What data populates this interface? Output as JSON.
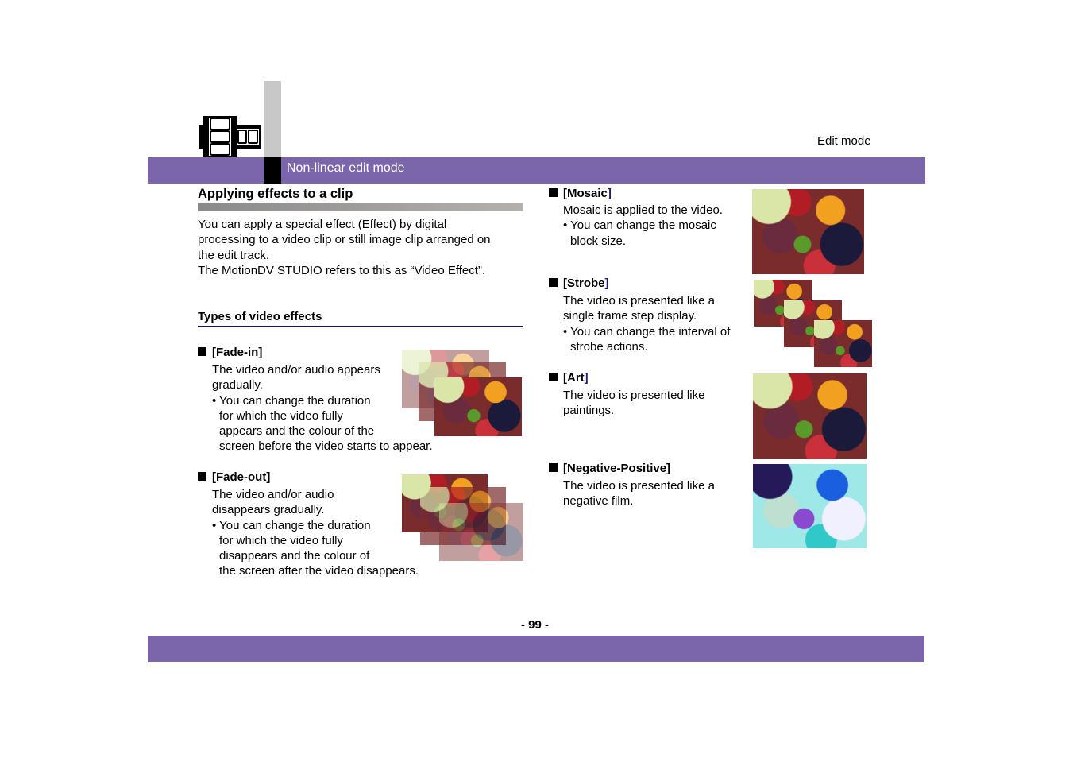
{
  "header": {
    "section_title": "Non-linear edit mode",
    "chapter": "Edit mode",
    "icon": "film-strip-icon",
    "accent_color": "#7b66ab"
  },
  "intro": {
    "heading": "Applying effects to a clip",
    "paragraph_lines": [
      "You can apply a special effect (Effect) by digital",
      "processing to a video clip or still image clip arranged on",
      "the edit track.",
      "The MotionDV STUDIO refers to this as “Video Effect”."
    ]
  },
  "types": {
    "heading": "Types of video effects"
  },
  "effects": [
    {
      "name": "Fade-in",
      "description_lines": [
        "The video and/or audio appears",
        "gradually."
      ],
      "bullet_lines": [
        "• You can change the duration",
        "for which the video fully",
        "appears and the colour of the",
        "screen before the video starts to appear."
      ],
      "image": "fade-in-preview"
    },
    {
      "name": "Fade-out",
      "description_lines": [
        "The video and/or audio",
        "disappears gradually."
      ],
      "bullet_lines": [
        "• You can change the duration",
        "for which the video fully",
        "disappears and the colour of",
        "the screen after the video disappears."
      ],
      "image": "fade-out-preview"
    },
    {
      "name": "Mosaic",
      "description_lines": [
        "Mosaic is applied to the video."
      ],
      "bullet_lines": [
        "• You can change the mosaic",
        "block size."
      ],
      "image": "mosaic-preview"
    },
    {
      "name": "Strobe",
      "description_lines": [
        "The video is presented like a",
        "single frame step display."
      ],
      "bullet_lines": [
        "• You can change the interval of",
        "strobe actions."
      ],
      "image": "strobe-preview"
    },
    {
      "name": "Art",
      "description_lines": [
        "The video is presented like",
        "paintings."
      ],
      "bullet_lines": [],
      "image": "art-preview"
    },
    {
      "name": "Negative-Positive",
      "description_lines": [
        "The video is presented like a",
        "negative film."
      ],
      "bullet_lines": [],
      "image": "negative-positive-preview"
    }
  ],
  "footer": {
    "page_number": "- 99 -"
  }
}
